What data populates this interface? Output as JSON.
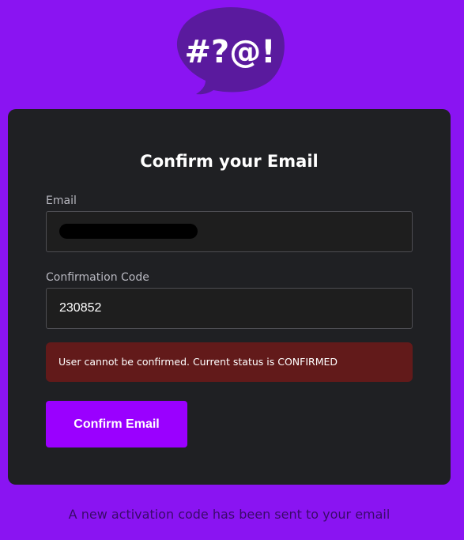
{
  "logo": {
    "icon": "speech-bubble-symbols-icon",
    "text": "#?@!",
    "bubble_color": "#5a1a9e"
  },
  "form": {
    "title": "Confirm your Email",
    "email": {
      "label": "Email",
      "value": ""
    },
    "code": {
      "label": "Confirmation Code",
      "value": "230852"
    },
    "error": "User cannot be confirmed. Current status is CONFIRMED",
    "submit_label": "Confirm Email"
  },
  "footer": {
    "message": "A new activation code has been sent to your email"
  },
  "colors": {
    "background": "#8a14f2",
    "card": "#1f2023",
    "button": "#9a00ff",
    "error_bg": "#621a1a"
  }
}
